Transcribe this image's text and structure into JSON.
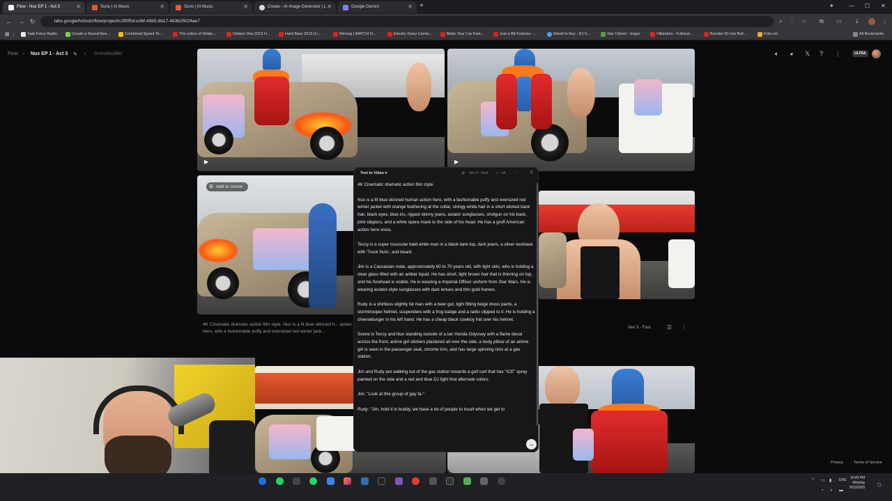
{
  "browser": {
    "tabs": [
      {
        "title": "Flow - Nux EP 1 - Act 3",
        "active": true
      },
      {
        "title": "Suno | AI Music",
        "active": false
      },
      {
        "title": "Suno | AI Music",
        "active": false
      },
      {
        "title": "Create - AI Image Generator | L",
        "active": false
      },
      {
        "title": "Google Gemini",
        "active": false
      }
    ],
    "url": "labs.google/fx/tools/flow/project/c1ff0f5d-e3bf-49b5-8b17-483b25024ae7",
    "bookmarks": [
      "Task Force Radio",
      "Create a Sound Rea...",
      "Combined Speed Te...",
      "The colors of Defqo...",
      "Defqon One 2013 H...",
      "Hard Bass 2013 (Li...",
      "Mirmag | WATCH D...",
      "Electric Daisy Carniv...",
      "Make Your Car Fast...",
      "Just a Bit Fortress -...",
      "Mixed In Key - DJ S...",
      "Star Citizen - Imgur",
      "Villalobos - Fulheue...",
      "Bonobo 50 min Boil...",
      "Kritz.net"
    ],
    "all_bookmarks": "All Bookmarks"
  },
  "app": {
    "breadcrumb": {
      "root": "Flow",
      "project": "Nux EP 1 - Act 3",
      "section": "Scenebuilder"
    },
    "badge": "ULTRA",
    "add_to_scene": "Add to scene",
    "tile_caption": "4K Cinematic dramatic action film style. Nux is a fit blue skinned h... action hero, with a fashionable puffy and oversized red winter jack...",
    "row_model": "Veo 3 - Fast",
    "footer": {
      "privacy": "Privacy",
      "terms": "Terms of Service"
    }
  },
  "panel": {
    "mode": "Text to Video",
    "model": "Veo 3 - Fast",
    "count": "x4",
    "paragraphs": [
      "4K Cinematic  dramatic action film style.",
      "Nux is a fit blue skinned human action hero, with a fashionable puffy and oversized red winter jacket with orange feathering at the collar, stringy white hair in a short slicked back hair, black eyes, blue iris, ripped skinny jeans, aviator sunglasses, shotgun on his back, pink slippers, and a white opera mask to the side of his head. He has a gruff American action hero voice.",
      "Teccy is a super muscular bald white man in a black tank top, dark jeans, a silver necklace with 'Truck Nuts', and beard.",
      "Jim is a Caucasian male, approximately 60 to 70 years old, with light skin, who is holding a clear glass filled with an amber liquid. He has short, light brown hair that is thinning on top, and his forehead is visible. He is wearing a Imperial Officer uniform from Star Wars. He is wearing aviator-style sunglasses with dark lenses and thin gold frames.",
      "Rudy is a shirtless slightly fat man with a beer gut, tight fitting beige dress pants, a stormtrooper helmet, suspenders with a frog badge and a radio clipped to it. He is holding a cheeseburger in his left hand. He has a cheap black cowboy hat over his helmet.",
      "Scene is Teccy and Nux standing outside of a tan Honda Odyssey with a flame decal across the front, anime girl stickers plastered all over the side, a body pillow of an anime girl is seen in the passenger seat, chrome trim, and has large spinning rims at a gas station.",
      "Jim and Rudy are walking out of the gas station towards a golf cart that has \"ICE\" spray painted on the side and a red and blue DJ light that alternate colors.",
      "Jim: \"Look at this group of gay fa-\"",
      "Rudy: \"Jim, hold it in buddy, we have a lot of people to insult when we get to"
    ]
  },
  "taskbar": {
    "lang": "ENG",
    "time": "10:49 PM",
    "day": "Monday",
    "date": "9/15/2025"
  },
  "colors": {
    "app_bg": "#0b0b0c",
    "panel_bg": "#17171a",
    "jacket_red": "#e22c2c",
    "hero_blue": "#3a7ed6"
  }
}
